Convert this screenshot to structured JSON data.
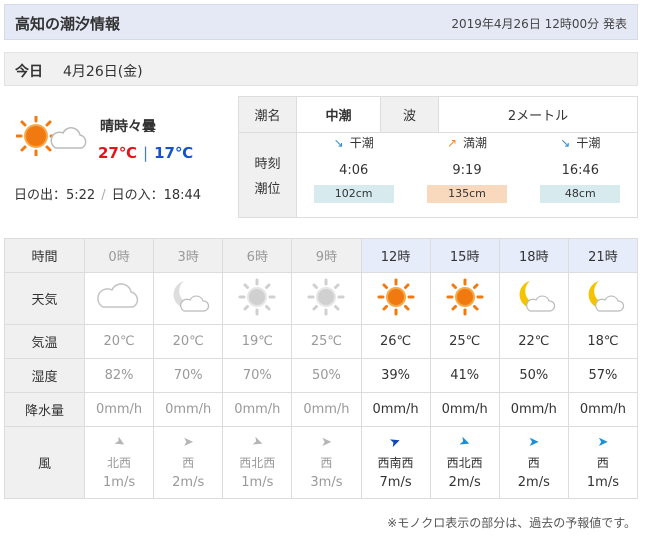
{
  "header": {
    "title": "高知の潮汐情報",
    "announce": "2019年4月26日 12時00分 発表"
  },
  "day": {
    "today_label": "今日",
    "date": "4月26日(金)"
  },
  "summary": {
    "condition": "晴時々曇",
    "high": "27℃",
    "separator": "|",
    "low": "17℃",
    "sunrise": "日の出：5:22",
    "sunset": "日の入：18:44",
    "icon": "sun-cloud-icon"
  },
  "tide": {
    "name_label": "潮名",
    "name_value": "中潮",
    "wave_label": "波",
    "wave_value": "2メートル",
    "time_label_1": "時刻",
    "time_label_2": "潮位",
    "events": [
      {
        "type": "干潮",
        "arrow": "↘",
        "time": "4:06",
        "level": "102cm"
      },
      {
        "type": "満潮",
        "arrow": "↗",
        "time": "9:19",
        "level": "135cm"
      },
      {
        "type": "干潮",
        "arrow": "↘",
        "time": "16:46",
        "level": "48cm"
      }
    ]
  },
  "forecast": {
    "labels": {
      "time": "時間",
      "weather": "天気",
      "temp": "気温",
      "humidity": "湿度",
      "rain": "降水量",
      "wind": "風"
    },
    "hours": [
      {
        "time": "0時",
        "past": true,
        "icon": "cloud-icon",
        "temp": "20℃",
        "humidity": "82%",
        "rain": "0mm/h",
        "wind_dir": "北西",
        "wind_speed": "1m/s"
      },
      {
        "time": "3時",
        "past": true,
        "icon": "moon-cloud-icon",
        "temp": "20℃",
        "humidity": "70%",
        "rain": "0mm/h",
        "wind_dir": "西",
        "wind_speed": "2m/s"
      },
      {
        "time": "6時",
        "past": true,
        "icon": "sun-icon",
        "temp": "19℃",
        "humidity": "70%",
        "rain": "0mm/h",
        "wind_dir": "西北西",
        "wind_speed": "1m/s"
      },
      {
        "time": "9時",
        "past": true,
        "icon": "sun-icon",
        "temp": "25℃",
        "humidity": "50%",
        "rain": "0mm/h",
        "wind_dir": "西",
        "wind_speed": "3m/s"
      },
      {
        "time": "12時",
        "past": false,
        "icon": "sun-icon",
        "temp": "26℃",
        "humidity": "39%",
        "rain": "0mm/h",
        "wind_dir": "西南西",
        "wind_speed": "7m/s"
      },
      {
        "time": "15時",
        "past": false,
        "icon": "sun-icon",
        "temp": "25℃",
        "humidity": "41%",
        "rain": "0mm/h",
        "wind_dir": "西北西",
        "wind_speed": "2m/s"
      },
      {
        "time": "18時",
        "past": false,
        "icon": "moon-cloud-icon",
        "temp": "22℃",
        "humidity": "50%",
        "rain": "0mm/h",
        "wind_dir": "西",
        "wind_speed": "2m/s"
      },
      {
        "time": "21時",
        "past": false,
        "icon": "moon-cloud-icon",
        "temp": "18℃",
        "humidity": "57%",
        "rain": "0mm/h",
        "wind_dir": "西",
        "wind_speed": "1m/s"
      }
    ]
  },
  "note": "※モノクロ表示の部分は、過去の予報値です。",
  "colors": {
    "high_temp": "#e0161c",
    "low_temp": "#1553c6",
    "sun": "#f07a10",
    "moon": "#f5c400",
    "past": "#999999",
    "wind_future": "#1a8fd8",
    "wind_strong": "#1046b8"
  }
}
